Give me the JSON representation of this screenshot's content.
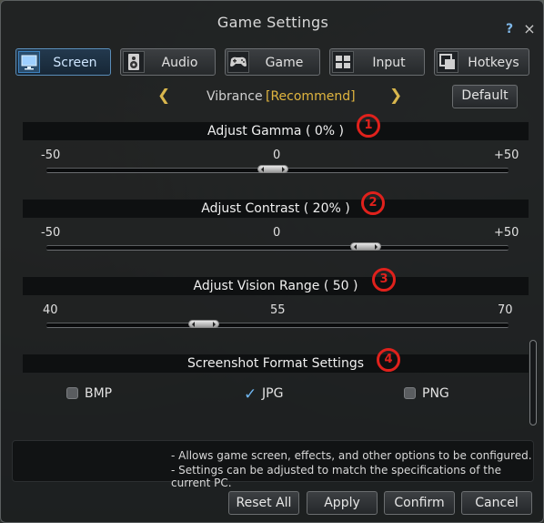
{
  "window": {
    "title": "Game Settings"
  },
  "titlebar": {
    "help": "?",
    "close": "×"
  },
  "tabs": [
    {
      "label": "Screen",
      "icon": "monitor-icon",
      "active": true
    },
    {
      "label": "Audio",
      "icon": "speaker-icon",
      "active": false
    },
    {
      "label": "Game",
      "icon": "gamepad-icon",
      "active": false
    },
    {
      "label": "Input",
      "icon": "keyboard-icon",
      "active": false
    },
    {
      "label": "Hotkeys",
      "icon": "hotkeys-icon",
      "active": false
    }
  ],
  "vibrance": {
    "label": "Vibrance",
    "value": "[Recommend]",
    "prev": "❮",
    "next": "❯",
    "default_label": "Default"
  },
  "gamma": {
    "title": "Adjust Gamma ( 0% )",
    "marker": "1",
    "min_label": "-50",
    "mid_label": "0",
    "max_label": "+50",
    "level": 0.49
  },
  "contrast": {
    "title": "Adjust Contrast ( 20% )",
    "marker": "2",
    "min_label": "-50",
    "mid_label": "0",
    "max_label": "+50",
    "level": 0.69
  },
  "vision": {
    "title": "Adjust Vision Range ( 50 )",
    "marker": "3",
    "min_label": "40",
    "mid_label": "55",
    "max_label": "70",
    "level": 0.34
  },
  "screenshot": {
    "title": "Screenshot Format Settings",
    "marker": "4",
    "options": [
      {
        "label": "BMP",
        "checked": false
      },
      {
        "label": "JPG",
        "checked": true
      },
      {
        "label": "PNG",
        "checked": false
      }
    ]
  },
  "info": {
    "line1": "- Allows game screen, effects, and other options to be configured.",
    "line2": "- Settings can be adjusted to match the specifications of the current PC."
  },
  "buttons": {
    "reset_all": "Reset All",
    "apply": "Apply",
    "confirm": "Confirm",
    "cancel": "Cancel"
  },
  "colors": {
    "accent_gold": "#e0b53f",
    "marker_red": "#e0211c",
    "check_blue": "#6fb6f0"
  }
}
